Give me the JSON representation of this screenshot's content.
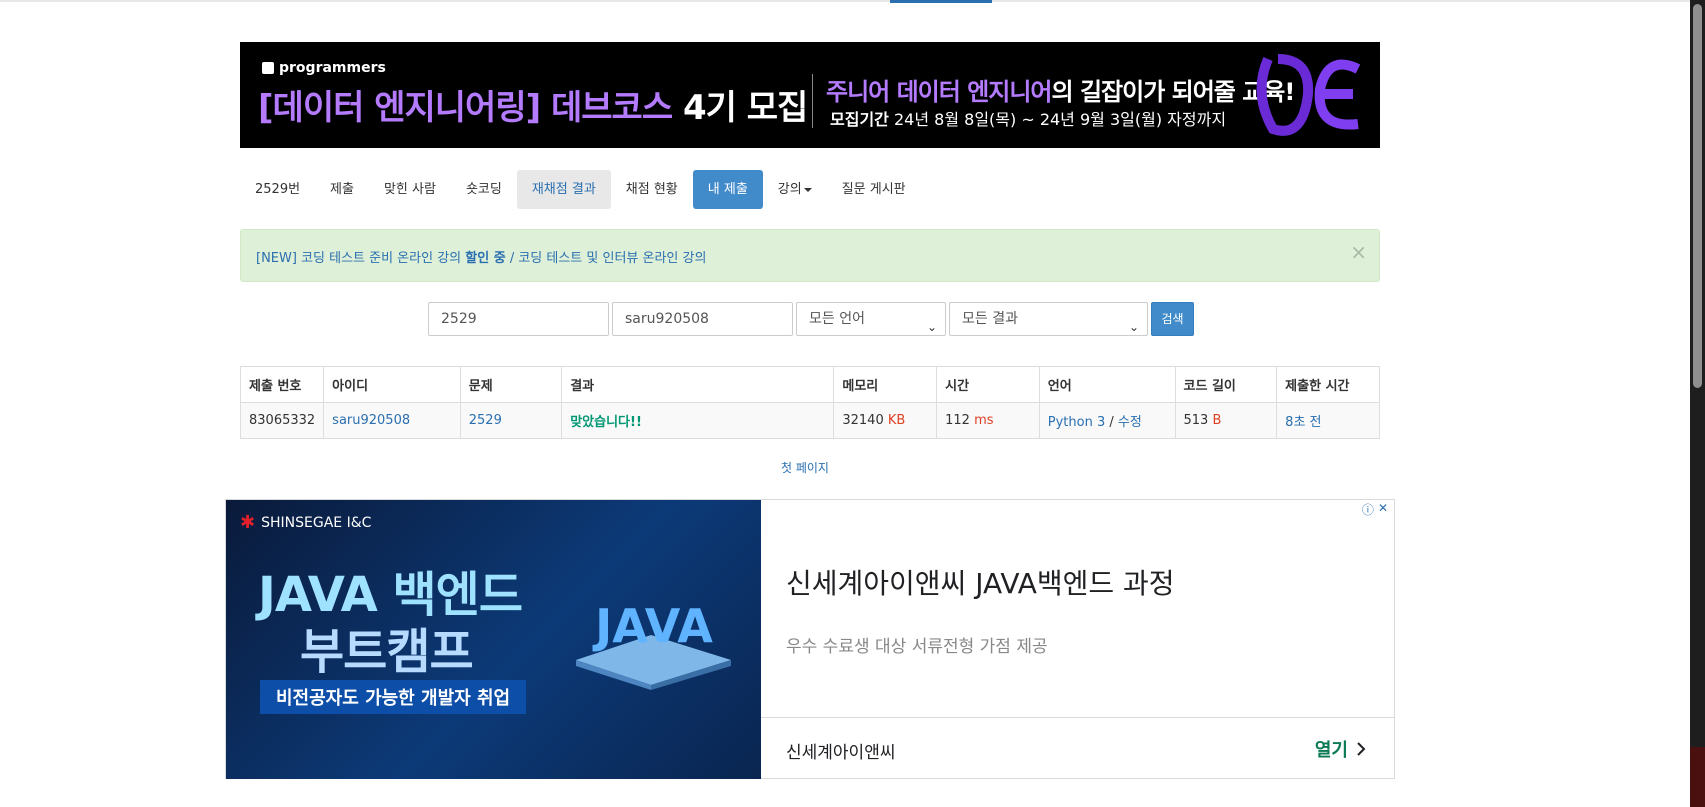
{
  "banner": {
    "logo": "programmers",
    "title_purple": "[데이터 엔지니어링] 데브코스",
    "title_white": "4기 모집",
    "sub_purple": "주니어 데이터 엔지니어",
    "sub_white": "의 길잡이가 되어줄 교육!",
    "date_label": "모집기간",
    "date_value": "24년 8월 8일(목) ~ 24년 9월 3일(월) 자정까지"
  },
  "nav": {
    "items": [
      {
        "label": "2529번"
      },
      {
        "label": "제출"
      },
      {
        "label": "맞힌 사람"
      },
      {
        "label": "숏코딩"
      },
      {
        "label": "재채점 결과"
      },
      {
        "label": "채점 현황"
      },
      {
        "label": "내 제출"
      },
      {
        "label": "강의"
      },
      {
        "label": "질문 게시판"
      }
    ]
  },
  "alert": {
    "part1": "[NEW] 코딩 테스트 준비 온라인 강의",
    "part2": "할인 중",
    "part3": "/ 코딩 테스트 및 인터뷰 온라인 강의",
    "close": "×"
  },
  "search": {
    "problem_value": "2529",
    "user_value": "saru920508",
    "language_selected": "모든 언어",
    "result_selected": "모든 결과",
    "button": "검색"
  },
  "table": {
    "headers": [
      "제출 번호",
      "아이디",
      "문제",
      "결과",
      "메모리",
      "시간",
      "언어",
      "코드 길이",
      "제출한 시간"
    ],
    "rows": [
      {
        "id": "83065332",
        "user": "saru920508",
        "problem": "2529",
        "result": "맞았습니다!!",
        "memory": "32140",
        "memory_unit": "KB",
        "time": "112",
        "time_unit": "ms",
        "language": "Python 3",
        "lang_sep": "/",
        "edit": "수정",
        "code_length": "513",
        "code_unit": "B",
        "submitted": "8초 전"
      }
    ]
  },
  "pagination": {
    "first": "첫 페이지"
  },
  "ad": {
    "brand": "SHINSEGAE I&C",
    "img_line1": "JAVA 백엔드",
    "img_line2": "부트캠프",
    "img_tag": "비전공자도 가능한 개발자 취업",
    "img_logo": "JAVA",
    "headline": "신세계아이앤씨 JAVA백엔드 과정",
    "description": "우수 수료생 대상 서류전형 가점 제공",
    "advertiser": "신세계아이앤씨",
    "open": "열기",
    "info_icon": "ⓘ",
    "close_icon": "✕"
  },
  "colors": {
    "primary": "#428bca",
    "link": "#2a6fb0",
    "success": "#009874",
    "unit_red": "#dd4124",
    "alert_bg": "#dff0d8",
    "banner_purple": "#b47bff"
  }
}
